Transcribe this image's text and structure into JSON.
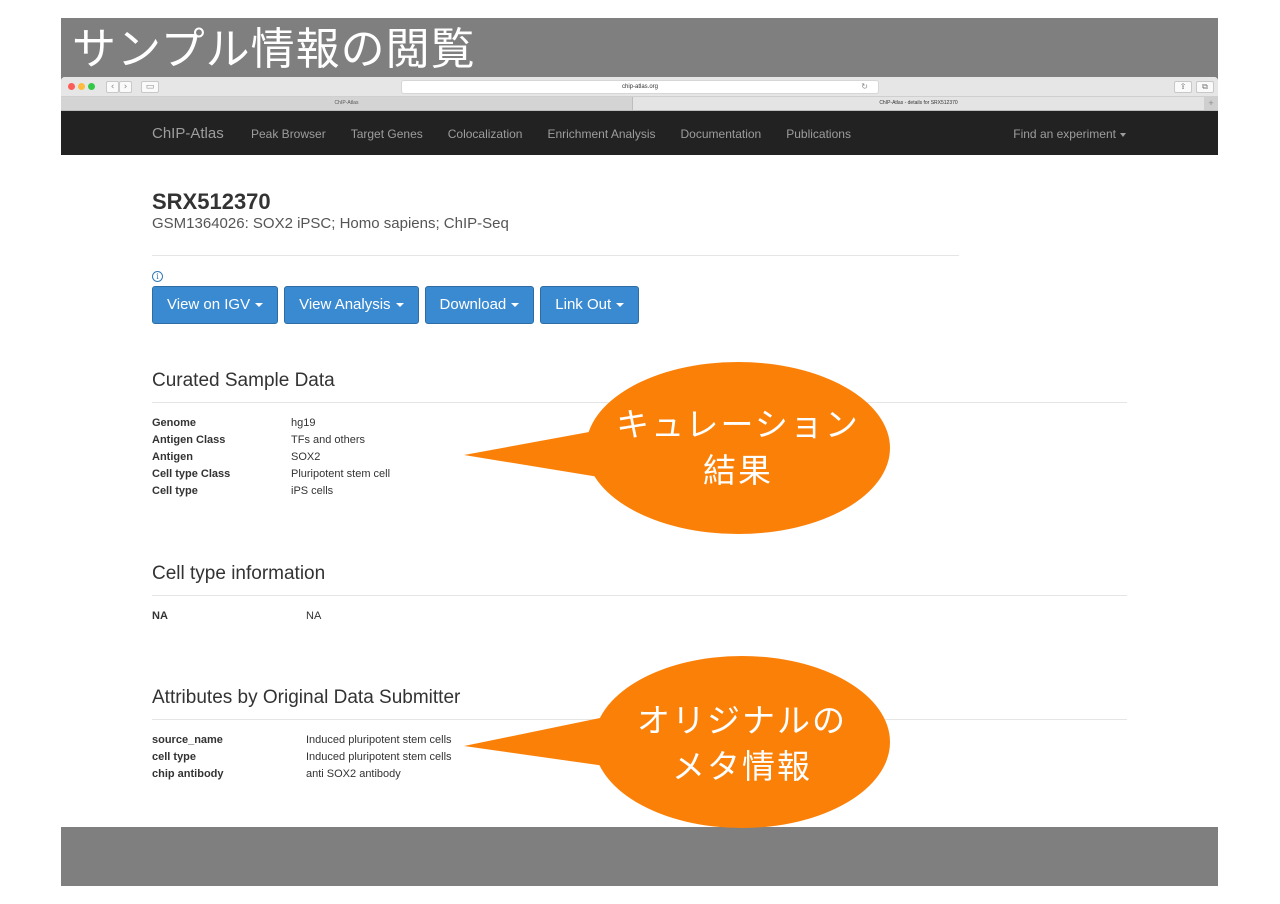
{
  "slide": {
    "title": "サンプル情報の閲覧"
  },
  "browser": {
    "url": "chip-atlas.org",
    "tabs": [
      {
        "label": "ChIP-Atlas",
        "active": false
      },
      {
        "label": "ChIP-Atlas - details for SRX512370",
        "active": true
      }
    ]
  },
  "navbar": {
    "brand": "ChIP-Atlas",
    "links": [
      "Peak Browser",
      "Target Genes",
      "Colocalization",
      "Enrichment Analysis",
      "Documentation",
      "Publications"
    ],
    "find": "Find an experiment"
  },
  "header": {
    "id": "SRX512370",
    "subtitle": "GSM1364026: SOX2 iPSC; Homo sapiens; ChIP-Seq"
  },
  "buttons": [
    "View on IGV",
    "View Analysis",
    "Download",
    "Link Out"
  ],
  "curated": {
    "heading": "Curated Sample Data",
    "rows": [
      {
        "key": "Genome",
        "value": "hg19"
      },
      {
        "key": "Antigen Class",
        "value": "TFs and others"
      },
      {
        "key": "Antigen",
        "value": "SOX2"
      },
      {
        "key": "Cell type Class",
        "value": "Pluripotent stem cell"
      },
      {
        "key": "Cell type",
        "value": "iPS cells"
      }
    ]
  },
  "celltype_info": {
    "heading": "Cell type information",
    "rows": [
      {
        "key": "NA",
        "value": "NA"
      }
    ]
  },
  "attributes": {
    "heading": "Attributes by Original Data Submitter",
    "rows": [
      {
        "key": "source_name",
        "value": "Induced pluripotent stem cells"
      },
      {
        "key": "cell type",
        "value": "Induced pluripotent stem cells"
      },
      {
        "key": "chip antibody",
        "value": "anti SOX2 antibody"
      }
    ]
  },
  "callouts": {
    "curation": {
      "line1": "キュレーション",
      "line2": "結果"
    },
    "original": {
      "line1": "オリジナルの",
      "line2": "メタ情報"
    }
  },
  "colors": {
    "callout": "#fa8008",
    "button": "#3a8ad2",
    "navbar": "#222222",
    "slide_bg": "#7f7f7f"
  }
}
